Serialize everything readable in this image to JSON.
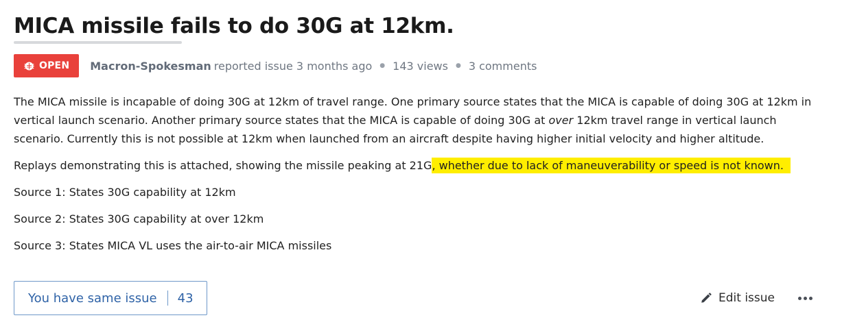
{
  "issue": {
    "title": "MICA missile fails to do 30G at 12km.",
    "status": "OPEN",
    "author": "Macron-Spokesman",
    "reported_text": "reported issue 3 months ago",
    "views": "143 views",
    "comments": "3 comments"
  },
  "body": {
    "p1_a": "The MICA missile is incapable of doing 30G at 12km of travel range. One primary source states that the MICA is capable of doing 30G at 12km in vertical launch scenario. Another primary source states that the MICA is capable of doing 30G at ",
    "p1_em": "over",
    "p1_b": " 12km travel range in vertical launch scenario. Currently this is not possible at 12km when launched from an aircraft despite having higher initial velocity and higher altitude.",
    "p2_a": "Replays demonstrating this is attached, showing the missile peaking at 21G",
    "p2_highlight": ", whether due to lack of maneuverability or speed is not known.",
    "source1": "Source 1: States 30G capability at 12km",
    "source2": "Source 2: States 30G capability at over 12km",
    "source3": "Source 3: States MICA VL uses the air-to-air MICA missiles"
  },
  "actions": {
    "same_issue_label": "You have same issue",
    "same_issue_count": "43",
    "edit_label": "Edit issue",
    "more_icon": "more-horizontal-icon"
  },
  "colors": {
    "badge_open": "#e9413b",
    "highlight": "#ffee00",
    "link_blue": "#2f63a7",
    "muted": "#6f7782"
  }
}
